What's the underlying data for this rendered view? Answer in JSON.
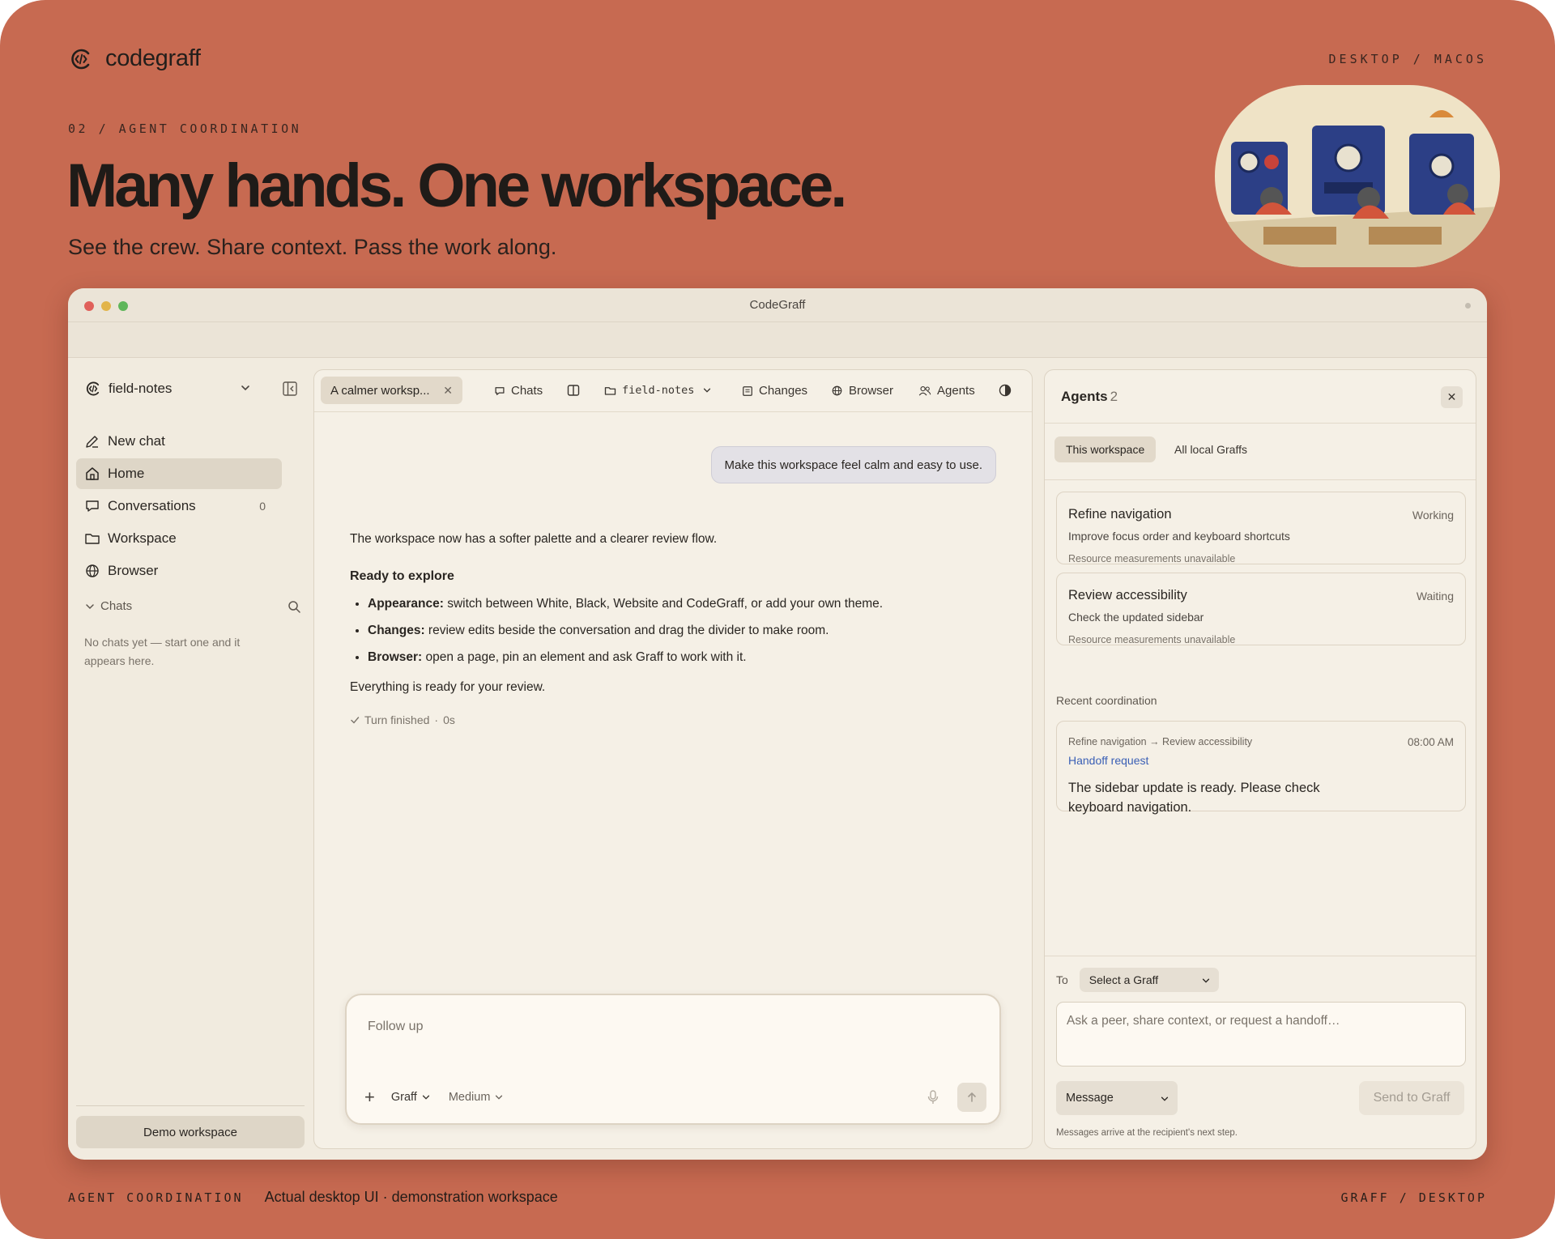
{
  "brand": {
    "name": "codegraff"
  },
  "hero": {
    "platform": "DESKTOP / MACOS",
    "eyebrow": "02 / AGENT COORDINATION",
    "headline": "Many hands. One workspace.",
    "subhead": "See the crew. Share context. Pass the work along.",
    "illustration": "illustration of mice operating blue machines"
  },
  "window": {
    "title": "CodeGraff",
    "traffic_lights": [
      "#e0605a",
      "#e2b44a",
      "#5fb65a"
    ]
  },
  "sidebar": {
    "workspace_name": "field-notes",
    "nav": [
      {
        "label": "New chat",
        "icon": "pencil-icon"
      },
      {
        "label": "Home",
        "icon": "home-icon",
        "active": true
      },
      {
        "label": "Conversations",
        "icon": "chat-bubble-icon",
        "count": "0"
      },
      {
        "label": "Workspace",
        "icon": "folder-icon"
      },
      {
        "label": "Browser",
        "icon": "globe-icon"
      }
    ],
    "chats_label": "Chats",
    "empty_note": "No chats yet — start one and it appears here.",
    "demo_button": "Demo workspace"
  },
  "center": {
    "active_tab": "A calmer worksp...",
    "toolbar": {
      "chats": "Chats",
      "folder": "field-notes",
      "changes": "Changes",
      "browser": "Browser",
      "agents": "Agents"
    },
    "user_message": "Make this workspace feel calm and easy to use.",
    "reply": {
      "intro": "The workspace now has a softer palette and a clearer review flow.",
      "heading": "Ready to explore",
      "bullets": [
        {
          "term": "Appearance:",
          "text": " switch between White, Black, Website and CodeGraff, or add your own theme."
        },
        {
          "term": "Changes:",
          "text": " review edits beside the conversation and drag the divider to make room."
        },
        {
          "term": "Browser:",
          "text": " open a page, pin an element and ask Graff to work with it."
        }
      ],
      "closing": "Everything is ready for your review."
    },
    "turn_status": "Turn finished",
    "turn_separator": "·",
    "turn_duration": "0s",
    "composer": {
      "placeholder": "Follow up",
      "model": "Graff",
      "effort": "Medium"
    }
  },
  "agents_panel": {
    "title": "Agents",
    "count": "2",
    "tabs": [
      "This workspace",
      "All local Graffs"
    ],
    "cards": [
      {
        "title": "Refine navigation",
        "status": "Working",
        "description": "Improve focus order and keyboard shortcuts",
        "meta": "Resource measurements unavailable"
      },
      {
        "title": "Review accessibility",
        "status": "Waiting",
        "description": "Check the updated sidebar",
        "meta": "Resource measurements unavailable"
      }
    ],
    "recent_label": "Recent coordination",
    "coordination": {
      "route": "Refine navigation → Review accessibility",
      "time": "08:00 AM",
      "tag": "Handoff request",
      "message": "The sidebar update is ready. Please check keyboard navigation."
    },
    "composer": {
      "to_label": "To",
      "to_placeholder": "Select a Graff",
      "input_placeholder": "Ask a peer, share context, or request a handoff…",
      "type": "Message",
      "send": "Send to Graff",
      "footnote": "Messages arrive at the recipient's next step."
    }
  },
  "footer": {
    "label": "AGENT COORDINATION",
    "description": "Actual desktop UI · demonstration workspace",
    "right": "GRAFF / DESKTOP"
  },
  "colors": {
    "background": "#c76a51",
    "window": "#f1ebdf",
    "link": "#3a5fb5"
  }
}
